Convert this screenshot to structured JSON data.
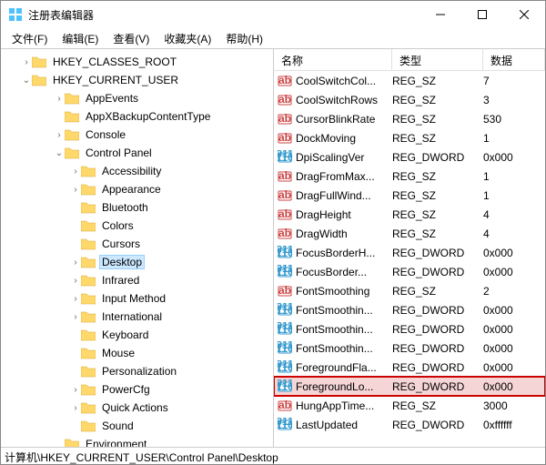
{
  "window": {
    "title": "注册表编辑器"
  },
  "menu": {
    "file": "文件(F)",
    "edit": "编辑(E)",
    "view": "查看(V)",
    "favorites": "收藏夹(A)",
    "help": "帮助(H)"
  },
  "columns": {
    "name": "名称",
    "type": "类型",
    "data": "数据"
  },
  "tree": {
    "root1": "HKEY_CLASSES_ROOT",
    "root2": "HKEY_CURRENT_USER",
    "items": [
      {
        "label": "AppEvents",
        "indent": 3,
        "exp": ">"
      },
      {
        "label": "AppXBackupContentType",
        "indent": 3,
        "exp": ""
      },
      {
        "label": "Console",
        "indent": 3,
        "exp": ">"
      },
      {
        "label": "Control Panel",
        "indent": 3,
        "exp": "v"
      },
      {
        "label": "Accessibility",
        "indent": 4,
        "exp": ">"
      },
      {
        "label": "Appearance",
        "indent": 4,
        "exp": ">"
      },
      {
        "label": "Bluetooth",
        "indent": 4,
        "exp": ""
      },
      {
        "label": "Colors",
        "indent": 4,
        "exp": ""
      },
      {
        "label": "Cursors",
        "indent": 4,
        "exp": ""
      },
      {
        "label": "Desktop",
        "indent": 4,
        "exp": ">",
        "selected": true
      },
      {
        "label": "Infrared",
        "indent": 4,
        "exp": ">"
      },
      {
        "label": "Input Method",
        "indent": 4,
        "exp": ">"
      },
      {
        "label": "International",
        "indent": 4,
        "exp": ">"
      },
      {
        "label": "Keyboard",
        "indent": 4,
        "exp": ""
      },
      {
        "label": "Mouse",
        "indent": 4,
        "exp": ""
      },
      {
        "label": "Personalization",
        "indent": 4,
        "exp": ""
      },
      {
        "label": "PowerCfg",
        "indent": 4,
        "exp": ">"
      },
      {
        "label": "Quick Actions",
        "indent": 4,
        "exp": ">"
      },
      {
        "label": "Sound",
        "indent": 4,
        "exp": ""
      },
      {
        "label": "Environment",
        "indent": 3,
        "exp": ""
      }
    ]
  },
  "values": [
    {
      "name": "CoolSwitchCol...",
      "type": "REG_SZ",
      "data": "7",
      "icon": "sz"
    },
    {
      "name": "CoolSwitchRows",
      "type": "REG_SZ",
      "data": "3",
      "icon": "sz"
    },
    {
      "name": "CursorBlinkRate",
      "type": "REG_SZ",
      "data": "530",
      "icon": "sz"
    },
    {
      "name": "DockMoving",
      "type": "REG_SZ",
      "data": "1",
      "icon": "sz"
    },
    {
      "name": "DpiScalingVer",
      "type": "REG_DWORD",
      "data": "0x000",
      "icon": "dw"
    },
    {
      "name": "DragFromMax...",
      "type": "REG_SZ",
      "data": "1",
      "icon": "sz"
    },
    {
      "name": "DragFullWind...",
      "type": "REG_SZ",
      "data": "1",
      "icon": "sz"
    },
    {
      "name": "DragHeight",
      "type": "REG_SZ",
      "data": "4",
      "icon": "sz"
    },
    {
      "name": "DragWidth",
      "type": "REG_SZ",
      "data": "4",
      "icon": "sz"
    },
    {
      "name": "FocusBorderH...",
      "type": "REG_DWORD",
      "data": "0x000",
      "icon": "dw"
    },
    {
      "name": "FocusBorder...",
      "type": "REG_DWORD",
      "data": "0x000",
      "icon": "dw"
    },
    {
      "name": "FontSmoothing",
      "type": "REG_SZ",
      "data": "2",
      "icon": "sz"
    },
    {
      "name": "FontSmoothin...",
      "type": "REG_DWORD",
      "data": "0x000",
      "icon": "dw"
    },
    {
      "name": "FontSmoothin...",
      "type": "REG_DWORD",
      "data": "0x000",
      "icon": "dw"
    },
    {
      "name": "FontSmoothin...",
      "type": "REG_DWORD",
      "data": "0x000",
      "icon": "dw"
    },
    {
      "name": "ForegroundFla...",
      "type": "REG_DWORD",
      "data": "0x000",
      "icon": "dw"
    },
    {
      "name": "ForegroundLo...",
      "type": "REG_DWORD",
      "data": "0x000",
      "icon": "dw",
      "selected": true
    },
    {
      "name": "HungAppTime...",
      "type": "REG_SZ",
      "data": "3000",
      "icon": "sz"
    },
    {
      "name": "LastUpdated",
      "type": "REG_DWORD",
      "data": "0xffffff",
      "icon": "dw"
    }
  ],
  "status": "计算机\\HKEY_CURRENT_USER\\Control Panel\\Desktop"
}
